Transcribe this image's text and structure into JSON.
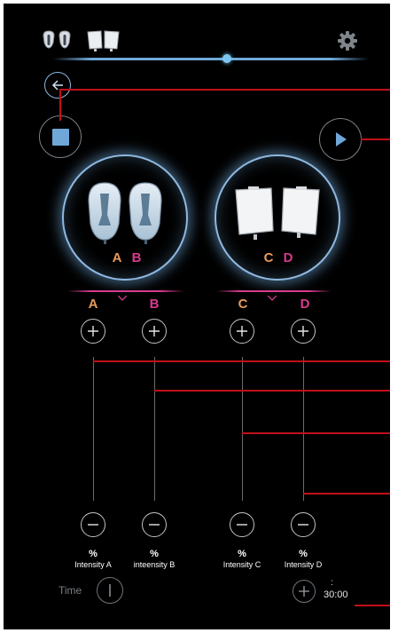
{
  "header": {
    "icons": [
      "electrode-pads-small-icon",
      "electrode-pads-large-icon",
      "gear-icon"
    ],
    "progress": 0.55
  },
  "groups": [
    {
      "id": "AB",
      "letters": [
        "A",
        "B"
      ]
    },
    {
      "id": "CD",
      "letters": [
        "C",
        "D"
      ]
    }
  ],
  "channels": [
    {
      "letter": "A",
      "pct": "%",
      "label": "Intensity A",
      "color": "#e89a5a"
    },
    {
      "letter": "B",
      "pct": "%",
      "label": "inteensity B",
      "color": "#d63b8d"
    },
    {
      "letter": "C",
      "pct": "%",
      "label": "Intensity C",
      "color": "#e89a5a"
    },
    {
      "letter": "D",
      "pct": "%",
      "label": "Intensity D",
      "color": "#d63b8d"
    }
  ],
  "time": {
    "label": "Time",
    "colon": ":",
    "value": "30:00"
  },
  "colors": {
    "accent_orange": "#e89a5a",
    "accent_pink": "#d63b8d",
    "callout_red": "#c0101a",
    "glow_blue": "#6fa8d8",
    "background": "#000000"
  }
}
